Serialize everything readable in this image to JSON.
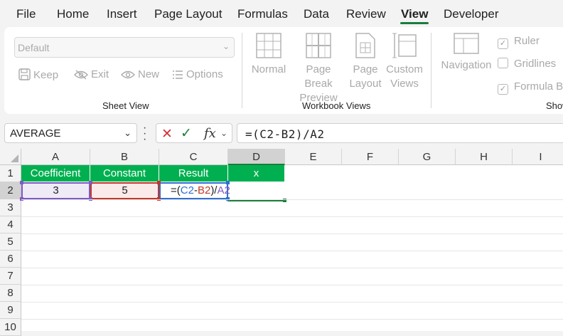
{
  "menu": {
    "tabs": [
      "File",
      "Home",
      "Insert",
      "Page Layout",
      "Formulas",
      "Data",
      "Review",
      "View",
      "Developer"
    ],
    "active_tab": "View"
  },
  "ribbon": {
    "sheet_view": {
      "select_value": "Default",
      "keep": "Keep",
      "exit": "Exit",
      "new": "New",
      "options": "Options",
      "label": "Sheet View"
    },
    "workbook_views": {
      "normal": "Normal",
      "page_break_1": "Page Break",
      "page_break_2": "Preview",
      "page_layout_1": "Page",
      "page_layout_2": "Layout",
      "custom_1": "Custom",
      "custom_2": "Views",
      "label": "Workbook Views"
    },
    "show": {
      "navigation": "Navigation",
      "ruler": "Ruler",
      "ruler_checked": true,
      "gridlines": "Gridlines",
      "gridlines_checked": false,
      "formula_bar": "Formula Ba",
      "formula_bar_checked": true,
      "label": "Show"
    }
  },
  "formula_bar": {
    "name_box": "AVERAGE",
    "cancel_icon": "✕",
    "enter_icon": "✓",
    "fx": "fx",
    "formula": "=(C2-B2)/A2"
  },
  "grid": {
    "columns": [
      "A",
      "B",
      "C",
      "D",
      "E",
      "F",
      "G",
      "H",
      "I"
    ],
    "rows": [
      "1",
      "2",
      "3",
      "4",
      "5",
      "6",
      "7",
      "8",
      "9",
      "10"
    ],
    "headers": [
      "Coefficient",
      "Constant",
      "Result",
      "x"
    ],
    "row2": {
      "A": "3",
      "B": "5"
    },
    "editing": {
      "eq": "=(",
      "ref1": "C2",
      "minus": "-",
      "ref2": "B2",
      "close": ")/",
      "ref3": "A2"
    }
  },
  "colors": {
    "accent": "#1a7d3c",
    "header_fill": "#00b050",
    "ref_blue": "#2e6fd1",
    "ref_red": "#c0392b",
    "ref_purple": "#7e5bc2"
  }
}
